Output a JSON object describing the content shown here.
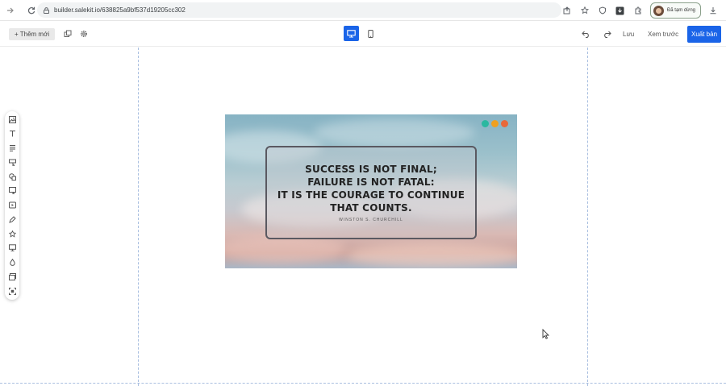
{
  "browser": {
    "url": "builder.salekit.io/638825a9bf537d19205cc302",
    "profile_label": "Đã tạm dừng"
  },
  "toolbar": {
    "add_new_label": "+ Thêm mới",
    "save_label": "Lưu",
    "preview_label": "Xem trước",
    "publish_label": "Xuất bản"
  },
  "banner": {
    "quote_lines": [
      "SUCCESS IS NOT FINAL;",
      "FAILURE IS NOT FATAL:",
      "IT IS THE COURAGE TO CONTINUE",
      "THAT COUNTS."
    ],
    "author": "WINSTON S. CHURCHILL",
    "dot_colors": [
      "#2bb8a0",
      "#f0a020",
      "#e8683a"
    ]
  },
  "colors": {
    "accent": "#1a64e8"
  },
  "palette_icons": [
    "image-icon",
    "text-icon",
    "paragraph-icon",
    "form-icon",
    "shape-icon",
    "popup-icon",
    "video-icon",
    "pen-icon",
    "star-icon",
    "monitor-icon",
    "drop-icon",
    "gallery-icon",
    "frame-icon"
  ]
}
